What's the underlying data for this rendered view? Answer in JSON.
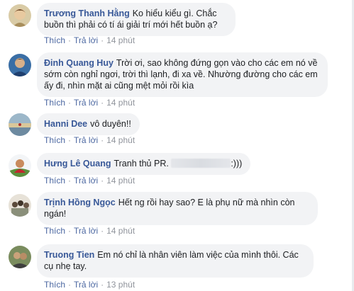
{
  "comments": [
    {
      "author": "Trương Thanh Hằng",
      "text": "Ko hiểu kiểu gì. Chắc buồn thì phải có tí ái giải trí mới hết buồn ạ?",
      "like": "Thích",
      "reply": "Trả lời",
      "time": "14 phút"
    },
    {
      "author": "Đinh Quang Huy",
      "text": "Trời ơi, sao không đứng gọn vào cho các em nó về sớm còn nghỉ ngơi, trời thì lạnh, đi xa về. Nhường đường cho các em ấy đi, nhìn mặt ai cũng mệt mỏi rồi kìa",
      "like": "Thích",
      "reply": "Trả lời",
      "time": "14 phút"
    },
    {
      "author": "Hanni Dee",
      "text": "vô duyên!!",
      "like": "Thích",
      "reply": "Trả lời",
      "time": "14 phút"
    },
    {
      "author": "Hưng Lê Quang",
      "text_before": "Tranh thủ PR.",
      "text_after": ":)))",
      "like": "Thích",
      "reply": "Trả lời",
      "time": "14 phút"
    },
    {
      "author": "Trịnh Hồng Ngọc",
      "text": "Hết ng rồi hay sao? E là phụ nữ mà nhìn còn ngán!",
      "like": "Thích",
      "reply": "Trả lời",
      "time": "14 phút"
    },
    {
      "author": "Truong Tien",
      "text": "Em nó chỉ là nhân viên làm việc của mình thôi. Các cụ nhẹ tay.",
      "like": "Thích",
      "reply": "Trả lời",
      "time": "13 phút"
    }
  ],
  "separator": "·",
  "colors": {
    "author": "#385898",
    "bubble": "#f2f3f5",
    "action_link": "#4b67a1",
    "meta": "#90949c"
  }
}
